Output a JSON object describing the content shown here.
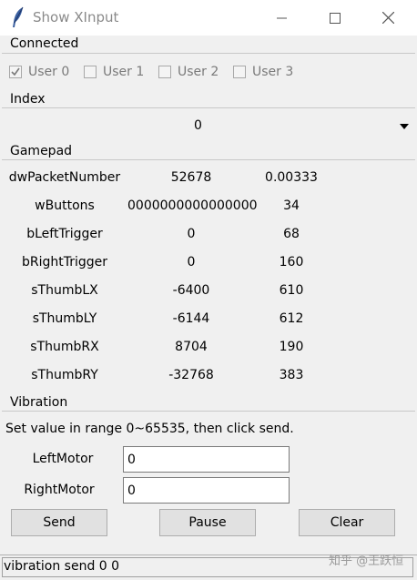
{
  "window": {
    "title": "Show XInput",
    "icon": "feather-icon"
  },
  "connected": {
    "label": "Connected",
    "users": [
      {
        "label": "User 0",
        "checked": true
      },
      {
        "label": "User 1",
        "checked": false
      },
      {
        "label": "User 2",
        "checked": false
      },
      {
        "label": "User 3",
        "checked": false
      }
    ]
  },
  "index": {
    "label": "Index",
    "selected": "0"
  },
  "gamepad": {
    "label": "Gamepad",
    "rows": [
      {
        "name": "dwPacketNumber",
        "value": "52678",
        "extra": "0.00333"
      },
      {
        "name": "wButtons",
        "value": "0000000000000000",
        "extra": "34"
      },
      {
        "name": "bLeftTrigger",
        "value": "0",
        "extra": "68"
      },
      {
        "name": "bRightTrigger",
        "value": "0",
        "extra": "160"
      },
      {
        "name": "sThumbLX",
        "value": "-6400",
        "extra": "610"
      },
      {
        "name": "sThumbLY",
        "value": "-6144",
        "extra": "612"
      },
      {
        "name": "sThumbRX",
        "value": "8704",
        "extra": "190"
      },
      {
        "name": "sThumbRY",
        "value": "-32768",
        "extra": "383"
      }
    ]
  },
  "vibration": {
    "label": "Vibration",
    "instruction": "Set value in range 0~65535, then click send.",
    "left_motor_label": "LeftMotor",
    "left_motor_value": "0",
    "right_motor_label": "RightMotor",
    "right_motor_value": "0",
    "send_label": "Send",
    "pause_label": "Pause",
    "clear_label": "Clear"
  },
  "status": {
    "text": "vibration send 0 0"
  },
  "watermark": "知乎 @王跃恒"
}
